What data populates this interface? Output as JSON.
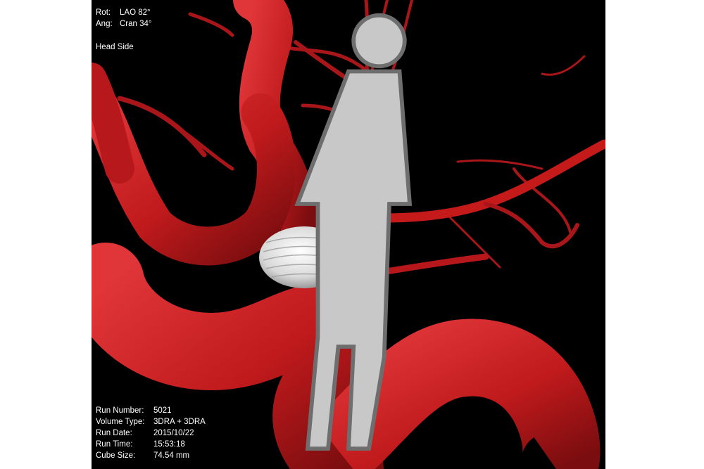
{
  "viewer": {
    "orientation": {
      "rot_label": "Rot:",
      "rot_value": "LAO 82°",
      "ang_label": "Ang:",
      "ang_value": "Cran 34°"
    },
    "view_side": "Head Side",
    "run_info": [
      {
        "label": "Run Number:",
        "value": "5021"
      },
      {
        "label": "Volume Type:",
        "value": "3DRA + 3DRA"
      },
      {
        "label": "Run Date:",
        "value": "2015/10/22"
      },
      {
        "label": "Run Time:",
        "value": "15:53:18"
      },
      {
        "label": "Cube Size:",
        "value": "74.54 mm"
      }
    ],
    "colors": {
      "background": "#000000",
      "vessel": "#c41a1a",
      "vessel_highlight": "#e23a3a",
      "aneurysm_device": "#e6e6e6",
      "overlay_text": "#ffffff"
    },
    "icons": {
      "patient_orientation": "standing-figure-icon"
    }
  }
}
